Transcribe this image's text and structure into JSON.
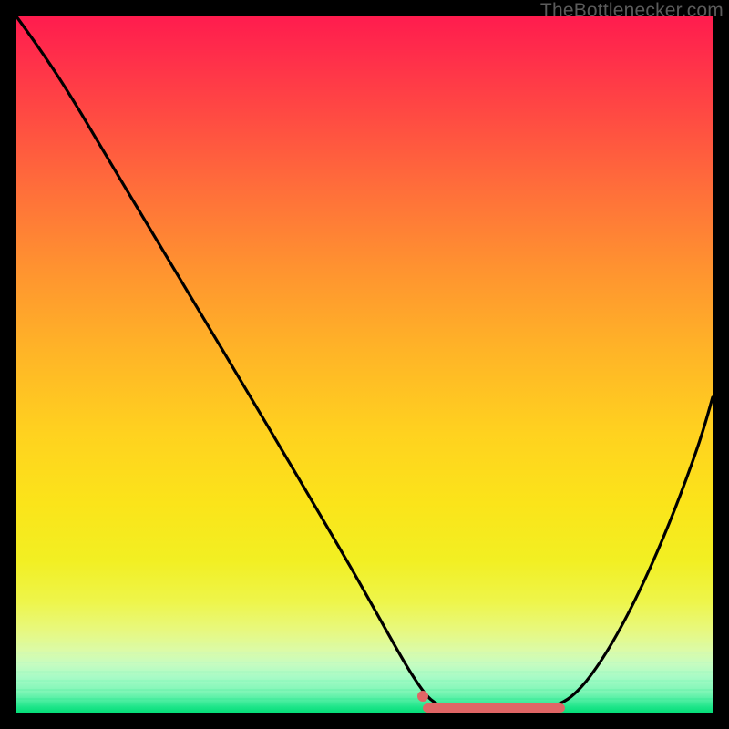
{
  "watermark": "TheBottlenecker.com",
  "colors": {
    "curve": "#000000",
    "flat_segment": "#e06666",
    "frame_bg": "#000000"
  },
  "chart_data": {
    "type": "line",
    "title": "",
    "xlabel": "",
    "ylabel": "",
    "xlim": [
      0,
      100
    ],
    "ylim": [
      0,
      100
    ],
    "grid": false,
    "legend": false,
    "x": [
      0,
      3,
      8,
      15,
      22,
      30,
      38,
      46,
      52,
      56,
      58,
      60,
      64,
      70,
      76,
      78,
      80,
      84,
      90,
      96,
      100
    ],
    "y": [
      100,
      96,
      90,
      80,
      70,
      58,
      46,
      32,
      20,
      12,
      7,
      4,
      1,
      0,
      0,
      1,
      3,
      8,
      20,
      35,
      45
    ],
    "series": [
      {
        "name": "bottleneck-curve",
        "color": "#000000",
        "x": [
          0,
          3,
          8,
          15,
          22,
          30,
          38,
          46,
          52,
          56,
          58,
          60,
          64,
          70,
          76,
          78,
          80,
          84,
          90,
          96,
          100
        ],
        "y": [
          100,
          96,
          90,
          80,
          70,
          58,
          46,
          32,
          20,
          12,
          7,
          4,
          1,
          0,
          0,
          1,
          3,
          8,
          20,
          35,
          45
        ]
      },
      {
        "name": "optimal-flat-segment",
        "color": "#e06666",
        "x": [
          58,
          78
        ],
        "y": [
          1.5,
          1.5
        ]
      }
    ],
    "annotations": [
      {
        "type": "dot",
        "x": 58,
        "y": 4,
        "color": "#e06666"
      }
    ],
    "background_gradient": {
      "direction": "top-to-bottom",
      "stops": [
        {
          "pos": 0.0,
          "color": "#ff1c4e"
        },
        {
          "pos": 0.5,
          "color": "#ffb427"
        },
        {
          "pos": 0.78,
          "color": "#f2ef22"
        },
        {
          "pos": 1.0,
          "color": "#05dd78"
        }
      ]
    }
  }
}
